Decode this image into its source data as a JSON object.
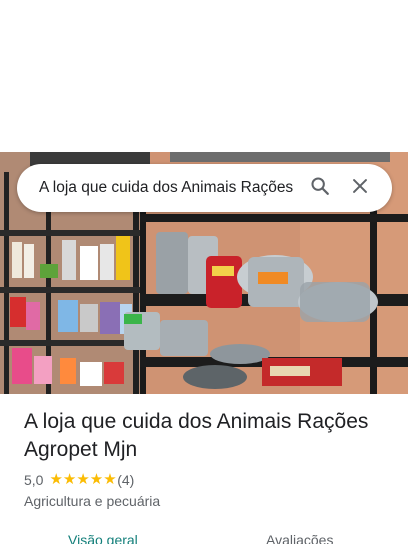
{
  "search": {
    "query": "A loja que cuida dos Animais Rações"
  },
  "place": {
    "title": "A loja que cuida dos Animais Rações Agropet Mjn",
    "rating": "5,0",
    "stars": "★★★★★",
    "review_count": "(4)",
    "category": "Agricultura e pecuária"
  },
  "tabs": [
    {
      "label": "Visão geral"
    },
    {
      "label": "Avaliações"
    }
  ],
  "icons": {
    "search": "search-icon",
    "close": "close-icon"
  },
  "colors": {
    "accent_tab": "#137f7a",
    "star": "#fbbc04",
    "wall": "#c98a6a"
  }
}
